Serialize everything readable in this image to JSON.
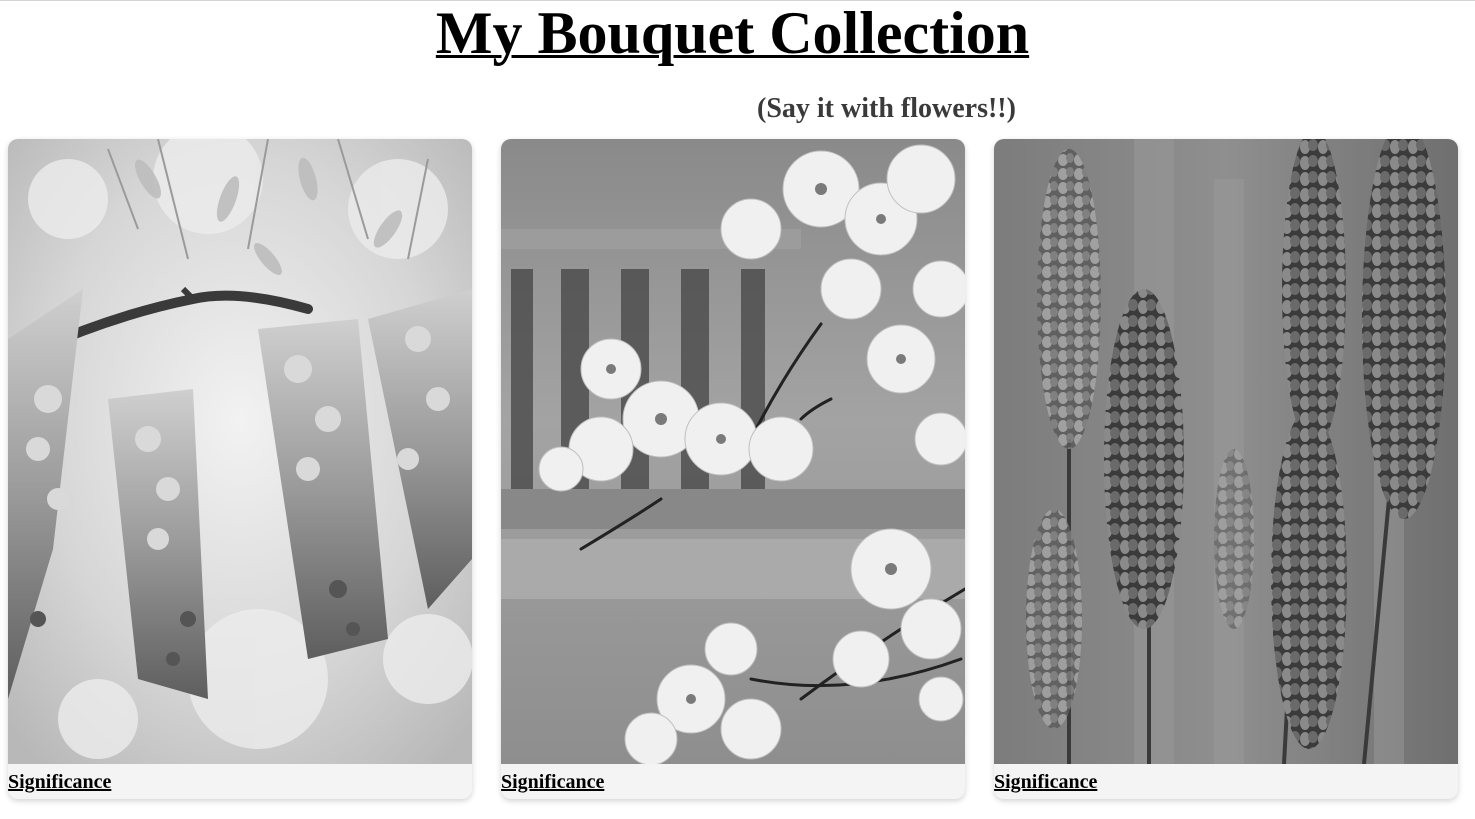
{
  "page": {
    "title": "My Bouquet Collection",
    "subtitle": "(Say it with flowers!!)"
  },
  "cards": [
    {
      "flower": "wisteria",
      "link_label": "Significance"
    },
    {
      "flower": "cherry-blossom",
      "link_label": "Significance"
    },
    {
      "flower": "lavender",
      "link_label": "Significance"
    }
  ],
  "colors": {
    "background": "#ffffff",
    "title": "#000000",
    "subtitle": "#3a3a3a"
  }
}
